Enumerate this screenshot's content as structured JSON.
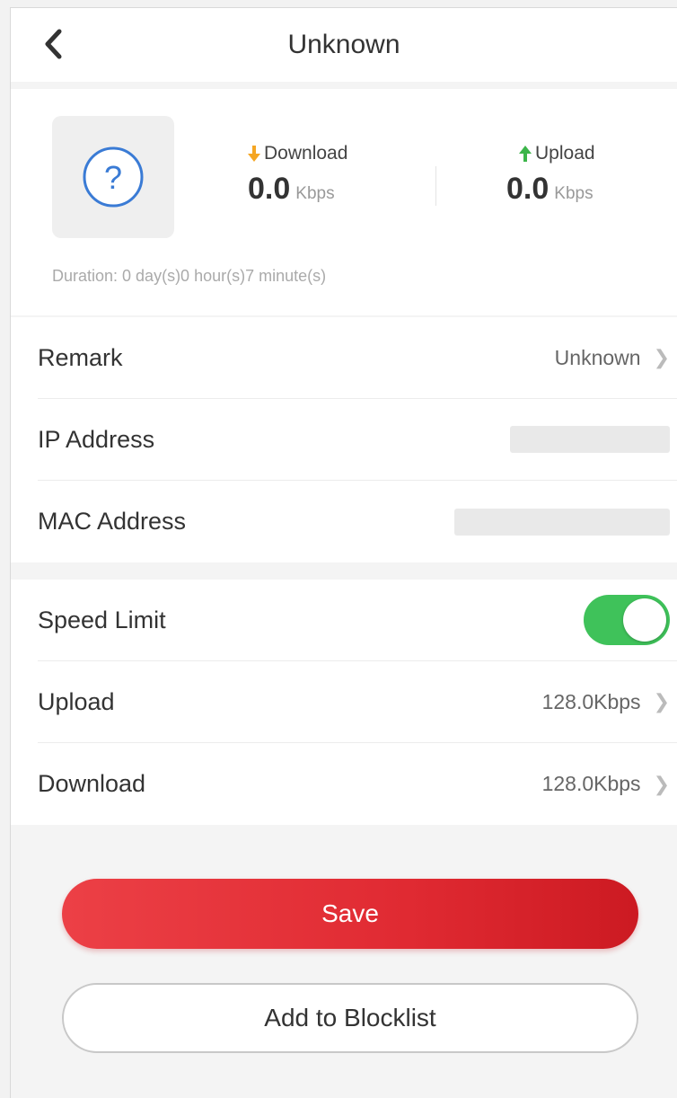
{
  "header": {
    "title": "Unknown",
    "back_icon": "chevron-left-icon"
  },
  "device": {
    "icon": "question-mark-icon",
    "download_label": "Download",
    "download_value": "0.0",
    "download_unit": "Kbps",
    "upload_label": "Upload",
    "upload_value": "0.0",
    "upload_unit": "Kbps",
    "duration": "Duration:  0 day(s)0 hour(s)7 minute(s)"
  },
  "info": {
    "remark_label": "Remark",
    "remark_value": "Unknown",
    "ip_label": "IP Address",
    "mac_label": "MAC Address"
  },
  "limits": {
    "speed_limit_label": "Speed Limit",
    "speed_limit_on": true,
    "upload_label": "Upload",
    "upload_value": "128.0Kbps",
    "download_label": "Download",
    "download_value": "128.0Kbps"
  },
  "actions": {
    "save_label": "Save",
    "blocklist_label": "Add to Blocklist"
  },
  "colors": {
    "accent_red": "#e02a32",
    "toggle_green": "#3fc25a",
    "download_arrow": "#f5a623",
    "upload_arrow": "#3cb54a",
    "question_blue": "#3a7bd5"
  }
}
